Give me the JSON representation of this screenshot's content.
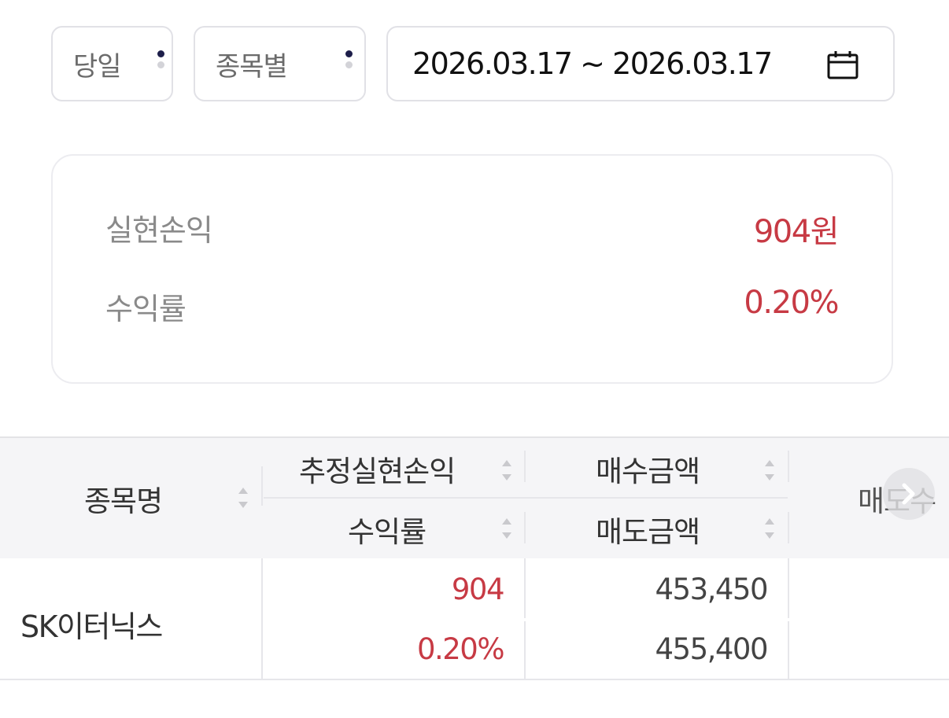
{
  "filters": {
    "period": "당일",
    "type": "종목별",
    "date_range": "2026.03.17 ~ 2026.03.17"
  },
  "summary": {
    "realized_pl_label": "실현손익",
    "realized_pl_value": "904원",
    "return_rate_label": "수익률",
    "return_rate_value": "0.20%"
  },
  "table": {
    "headers": {
      "stock_name": "종목명",
      "est_realized_pl": "추정실현손익",
      "return_rate": "수익률",
      "buy_amount": "매수금액",
      "sell_amount": "매도금액",
      "sell_qty_partial": "매도수"
    },
    "rows": [
      {
        "stock_name": "SK이터닉스",
        "est_realized_pl": "904",
        "return_rate": "0.20%",
        "buy_amount": "453,450",
        "sell_amount": "455,400"
      }
    ]
  },
  "colors": {
    "profit": "#c73a44",
    "accent_dot": "#1d1e4a"
  }
}
